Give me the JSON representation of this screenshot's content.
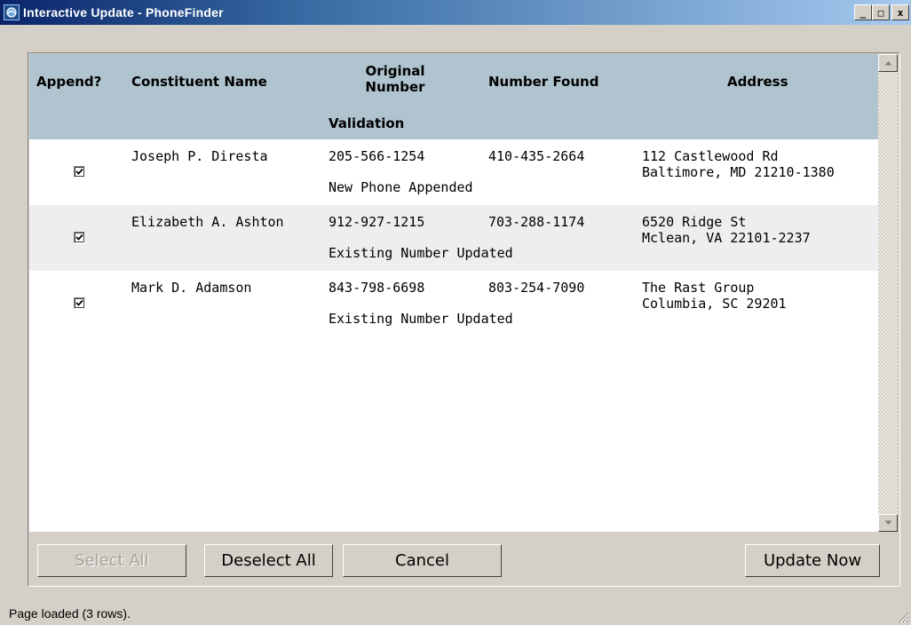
{
  "window": {
    "title": "Interactive Update - PhoneFinder",
    "minimize": "_",
    "maximize": "□",
    "close": "x"
  },
  "table": {
    "headers": {
      "append": "Append?",
      "name": "Constituent Name",
      "original_line1": "Original",
      "original_line2": "Number",
      "found": "Number Found",
      "address": "Address",
      "validation": "Validation"
    },
    "rows": [
      {
        "checked": true,
        "name": "Joseph P. Diresta",
        "original": "205-566-1254",
        "found": "410-435-2664",
        "address1": "112 Castlewood Rd",
        "address2": "Baltimore, MD 21210-1380",
        "validation": "New Phone Appended"
      },
      {
        "checked": true,
        "name": "Elizabeth A. Ashton",
        "original": "912-927-1215",
        "found": "703-288-1174",
        "address1": "6520 Ridge St",
        "address2": "Mclean, VA 22101-2237",
        "validation": "Existing Number Updated"
      },
      {
        "checked": true,
        "name": "Mark D. Adamson",
        "original": "843-798-6698",
        "found": "803-254-7090",
        "address1": "The Rast Group",
        "address2": "Columbia, SC 29201",
        "validation": "Existing Number Updated"
      }
    ]
  },
  "buttons": {
    "select_all": "Select All",
    "deselect_all": "Deselect All",
    "cancel": "Cancel",
    "update_now": "Update Now"
  },
  "status": "Page loaded (3 rows).",
  "colors": {
    "title_start": "#0a246a",
    "header_bg": "#b0c4cf",
    "alt_row_bg": "#eeeeef",
    "chrome": "#d4d0c8"
  }
}
